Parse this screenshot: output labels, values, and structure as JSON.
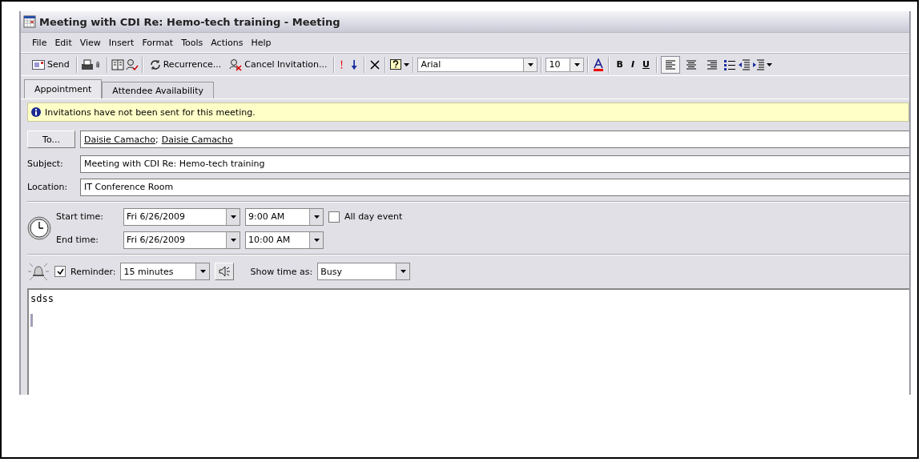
{
  "window": {
    "title": "Meeting with CDI Re:  Hemo-tech training - Meeting"
  },
  "menu": [
    "File",
    "Edit",
    "View",
    "Insert",
    "Format",
    "Tools",
    "Actions",
    "Help"
  ],
  "toolbar": {
    "send": "Send",
    "recurrence": "Recurrence...",
    "cancel": "Cancel Invitation...",
    "font": "Arial",
    "size": "10",
    "bold": "B",
    "italic": "I",
    "underline": "U",
    "align": [
      {
        "kind": "left",
        "selected": true
      },
      {
        "kind": "center",
        "selected": false
      },
      {
        "kind": "right",
        "selected": false
      }
    ]
  },
  "tabs": [
    {
      "label": "Appointment",
      "selected": true
    },
    {
      "label": "Attendee Availability",
      "selected": false
    }
  ],
  "infobar": "Invitations have not been sent for this meeting.",
  "to": {
    "button": "To...",
    "recipients": [
      "Daisie Camacho",
      "Daisie Camacho"
    ],
    "separator": ";"
  },
  "subject": {
    "label": "Subject:",
    "value": "Meeting with CDI Re:  Hemo-tech training"
  },
  "location": {
    "label": "Location:",
    "value": "IT Conference Room"
  },
  "start": {
    "label": "Start time:",
    "date": "Fri 6/26/2009",
    "time": "9:00 AM"
  },
  "end": {
    "label": "End time:",
    "date": "Fri 6/26/2009",
    "time": "10:00 AM"
  },
  "all_day": {
    "label": "All day event",
    "checked": false
  },
  "reminder": {
    "label": "Reminder:",
    "checked": true,
    "value": "15 minutes"
  },
  "show_time_as": {
    "label": "Show time as:",
    "value": "Busy"
  },
  "body": "sdss"
}
